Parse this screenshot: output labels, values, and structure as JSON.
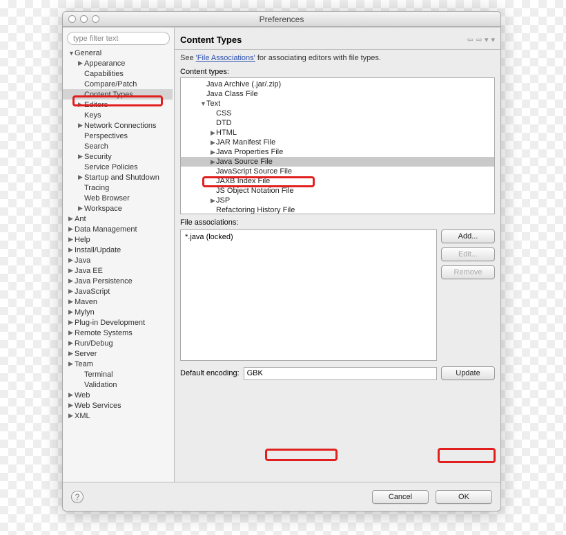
{
  "window": {
    "title": "Preferences"
  },
  "sidebar": {
    "filter_placeholder": "type filter text",
    "items": [
      {
        "label": "General",
        "expanded": true,
        "level": 0
      },
      {
        "label": "Appearance",
        "level": 1,
        "arrow": true
      },
      {
        "label": "Capabilities",
        "level": 1
      },
      {
        "label": "Compare/Patch",
        "level": 1
      },
      {
        "label": "Content Types",
        "level": 1,
        "selected": true
      },
      {
        "label": "Editors",
        "level": 1,
        "arrow": true
      },
      {
        "label": "Keys",
        "level": 1
      },
      {
        "label": "Network Connections",
        "level": 1,
        "arrow": true
      },
      {
        "label": "Perspectives",
        "level": 1
      },
      {
        "label": "Search",
        "level": 1
      },
      {
        "label": "Security",
        "level": 1,
        "arrow": true
      },
      {
        "label": "Service Policies",
        "level": 1
      },
      {
        "label": "Startup and Shutdown",
        "level": 1,
        "arrow": true
      },
      {
        "label": "Tracing",
        "level": 1
      },
      {
        "label": "Web Browser",
        "level": 1
      },
      {
        "label": "Workspace",
        "level": 1,
        "arrow": true
      },
      {
        "label": "Ant",
        "level": 0,
        "arrow": true
      },
      {
        "label": "Data Management",
        "level": 0,
        "arrow": true
      },
      {
        "label": "Help",
        "level": 0,
        "arrow": true
      },
      {
        "label": "Install/Update",
        "level": 0,
        "arrow": true
      },
      {
        "label": "Java",
        "level": 0,
        "arrow": true
      },
      {
        "label": "Java EE",
        "level": 0,
        "arrow": true
      },
      {
        "label": "Java Persistence",
        "level": 0,
        "arrow": true
      },
      {
        "label": "JavaScript",
        "level": 0,
        "arrow": true
      },
      {
        "label": "Maven",
        "level": 0,
        "arrow": true
      },
      {
        "label": "Mylyn",
        "level": 0,
        "arrow": true
      },
      {
        "label": "Plug-in Development",
        "level": 0,
        "arrow": true
      },
      {
        "label": "Remote Systems",
        "level": 0,
        "arrow": true
      },
      {
        "label": "Run/Debug",
        "level": 0,
        "arrow": true
      },
      {
        "label": "Server",
        "level": 0,
        "arrow": true
      },
      {
        "label": "Team",
        "level": 0,
        "arrow": true
      },
      {
        "label": "Terminal",
        "level": 1
      },
      {
        "label": "Validation",
        "level": 1
      },
      {
        "label": "Web",
        "level": 0,
        "arrow": true
      },
      {
        "label": "Web Services",
        "level": 0,
        "arrow": true
      },
      {
        "label": "XML",
        "level": 0,
        "arrow": true
      }
    ]
  },
  "content": {
    "heading": "Content Types",
    "description_prefix": "See ",
    "description_link": "'File Associations'",
    "description_suffix": " for associating editors with file types.",
    "content_types_label": "Content types:",
    "tree": [
      {
        "label": "Java Archive (.jar/.zip)",
        "indent": 1
      },
      {
        "label": "Java Class File",
        "indent": 1
      },
      {
        "label": "Text",
        "indent": 1,
        "expanded": true
      },
      {
        "label": "CSS",
        "indent": 2
      },
      {
        "label": "DTD",
        "indent": 2
      },
      {
        "label": "HTML",
        "indent": 2,
        "arrow": true
      },
      {
        "label": "JAR Manifest File",
        "indent": 2,
        "arrow": true
      },
      {
        "label": "Java Properties File",
        "indent": 2,
        "arrow": true
      },
      {
        "label": "Java Source File",
        "indent": 2,
        "arrow": true,
        "selected": true
      },
      {
        "label": "JavaScript Source File",
        "indent": 2
      },
      {
        "label": "JAXB Index File",
        "indent": 2
      },
      {
        "label": "JS Object Notation File",
        "indent": 2
      },
      {
        "label": "JSP",
        "indent": 2,
        "arrow": true
      },
      {
        "label": "Refactoring History File",
        "indent": 2
      }
    ],
    "file_assoc_label": "File associations:",
    "file_assoc_value": "*.java (locked)",
    "buttons": {
      "add": "Add...",
      "edit": "Edit...",
      "remove": "Remove"
    },
    "encoding_label": "Default encoding:",
    "encoding_value": "GBK",
    "update": "Update"
  },
  "footer": {
    "cancel": "Cancel",
    "ok": "OK"
  }
}
